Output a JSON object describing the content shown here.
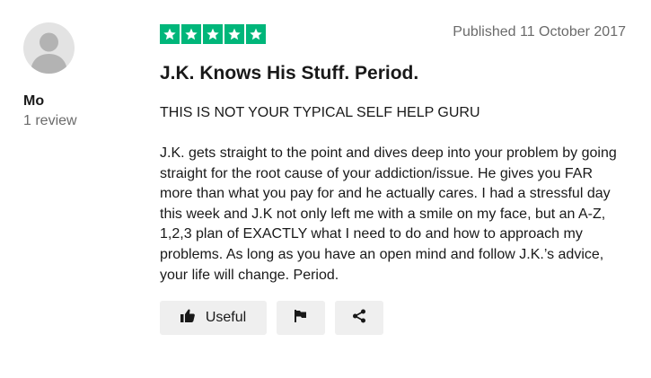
{
  "author": {
    "name": "Mo",
    "reviews": "1 review"
  },
  "review": {
    "rating": 5,
    "published": "Published 11 October 2017",
    "title": "J.K. Knows His Stuff. Period.",
    "subtitle": "THIS IS NOT YOUR TYPICAL SELF HELP GURU",
    "body": "J.K. gets straight to the point and dives deep into your problem by going straight for the root cause of your addiction/issue. He gives you FAR more than what you pay for and he actually cares. I had a stressful day this week and J.K not only left me with a smile on my face, but an A-Z, 1,2,3 plan of EXACTLY what I need to do and how to approach my problems. As long as you have an open mind and follow J.K.’s advice, your life will change. Period."
  },
  "actions": {
    "useful_label": "Useful",
    "icons": [
      "thumbs-up-icon",
      "flag-icon",
      "share-icon"
    ]
  },
  "colors": {
    "star_green": "#00b67a",
    "button_bg": "#efefef",
    "muted_text": "#6b6b6b"
  }
}
